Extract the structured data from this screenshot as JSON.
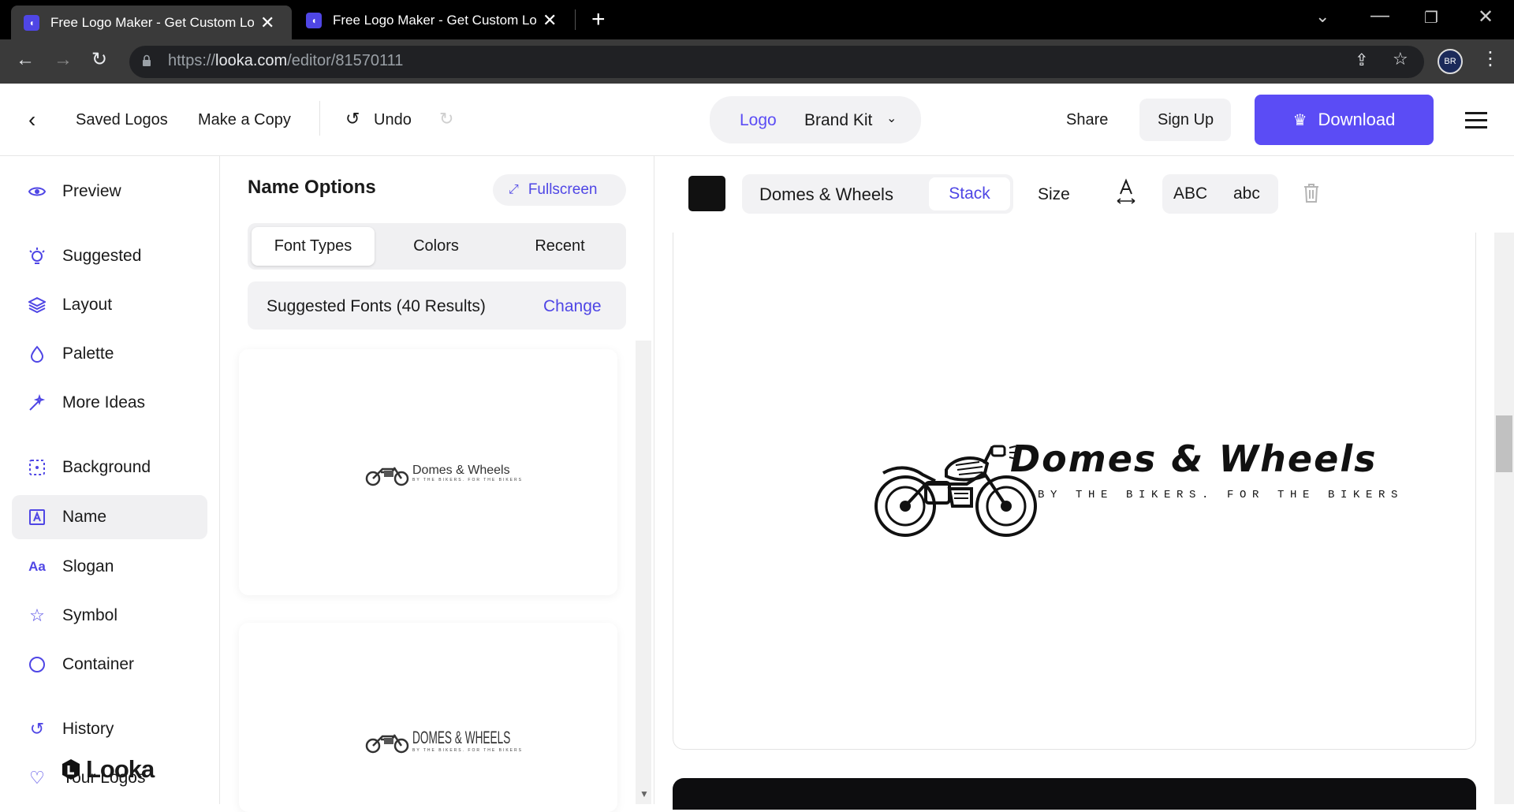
{
  "browser": {
    "tabs": [
      {
        "title": "Free Logo Maker - Get Custom Logo Designs",
        "active": true
      },
      {
        "title": "Free Logo Maker - Get Custom Logo Designs",
        "active": false
      }
    ],
    "url_prefix": "https://",
    "url_domain": "looka.com",
    "url_path": "/editor/81570111",
    "profile_initials": "BR"
  },
  "header": {
    "saved_logos": "Saved Logos",
    "make_copy": "Make a Copy",
    "undo": "Undo",
    "tab_logo": "Logo",
    "tab_brand_kit": "Brand Kit",
    "share": "Share",
    "sign_up": "Sign Up",
    "download": "Download"
  },
  "sidebar": {
    "items": [
      {
        "label": "Preview",
        "icon": "eye-icon"
      },
      {
        "label": "Suggested",
        "icon": "lightbulb-icon"
      },
      {
        "label": "Layout",
        "icon": "layers-icon"
      },
      {
        "label": "Palette",
        "icon": "droplet-icon"
      },
      {
        "label": "More Ideas",
        "icon": "magic-wand-icon"
      },
      {
        "label": "Background",
        "icon": "background-grid-icon"
      },
      {
        "label": "Name",
        "icon": "text-box-icon",
        "active": true
      },
      {
        "label": "Slogan",
        "icon": "font-icon"
      },
      {
        "label": "Symbol",
        "icon": "star-icon"
      },
      {
        "label": "Container",
        "icon": "circle-icon"
      },
      {
        "label": "History",
        "icon": "history-icon"
      },
      {
        "label": "Your Logos",
        "icon": "heart-icon"
      }
    ],
    "brand": "Looka"
  },
  "panel": {
    "title": "Name Options",
    "fullscreen": "Fullscreen",
    "tabs": [
      "Font Types",
      "Colors",
      "Recent"
    ],
    "active_tab": "Font Types",
    "suggested_label": "Suggested Fonts (40 Results)",
    "change": "Change",
    "previews": [
      {
        "name": "Domes & Wheels",
        "slogan": "BY THE BIKERS. FOR THE BIKERS"
      },
      {
        "name": "DOMES & WHEELS",
        "slogan": "BY THE BIKERS. FOR THE BIKERS"
      }
    ]
  },
  "toolbar": {
    "color_swatch": "#111111",
    "text_value": "Domes & Wheels",
    "stack": "Stack",
    "size": "Size",
    "upper": "ABC",
    "lower": "abc"
  },
  "logo": {
    "name": "Domes & Wheels",
    "slogan": "BY THE BIKERS. FOR THE BIKERS"
  },
  "colors": {
    "accent": "#5b4cf5",
    "chrome_dark": "#000000",
    "chrome_mid": "#3a3a3a"
  }
}
